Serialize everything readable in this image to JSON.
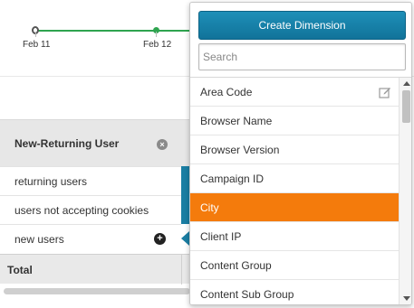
{
  "chart": {
    "x_labels": [
      "Feb 11",
      "Feb 12"
    ],
    "line_color": "#2ea44f"
  },
  "table": {
    "column_header": "New-Returning User",
    "rows": [
      {
        "label": "returning users"
      },
      {
        "label": "users not accepting cookies"
      },
      {
        "label": "new users"
      }
    ],
    "total_label": "Total",
    "remove_icon": "close-circle-icon",
    "add_icon": "plus-circle-icon"
  },
  "dropdown": {
    "create_label": "Create Dimension",
    "search_placeholder": "Search",
    "search_value": "",
    "items": [
      {
        "label": "Area Code",
        "has_edit": true
      },
      {
        "label": "Browser Name"
      },
      {
        "label": "Browser Version"
      },
      {
        "label": "Campaign ID"
      },
      {
        "label": "City",
        "selected": true
      },
      {
        "label": "Client IP"
      },
      {
        "label": "Content Group"
      },
      {
        "label": "Content Sub Group"
      }
    ],
    "edit_icon": "edit-icon"
  },
  "colors": {
    "accent": "#1a7ea3",
    "selected": "#f47b0c",
    "button": "#1580a8"
  }
}
